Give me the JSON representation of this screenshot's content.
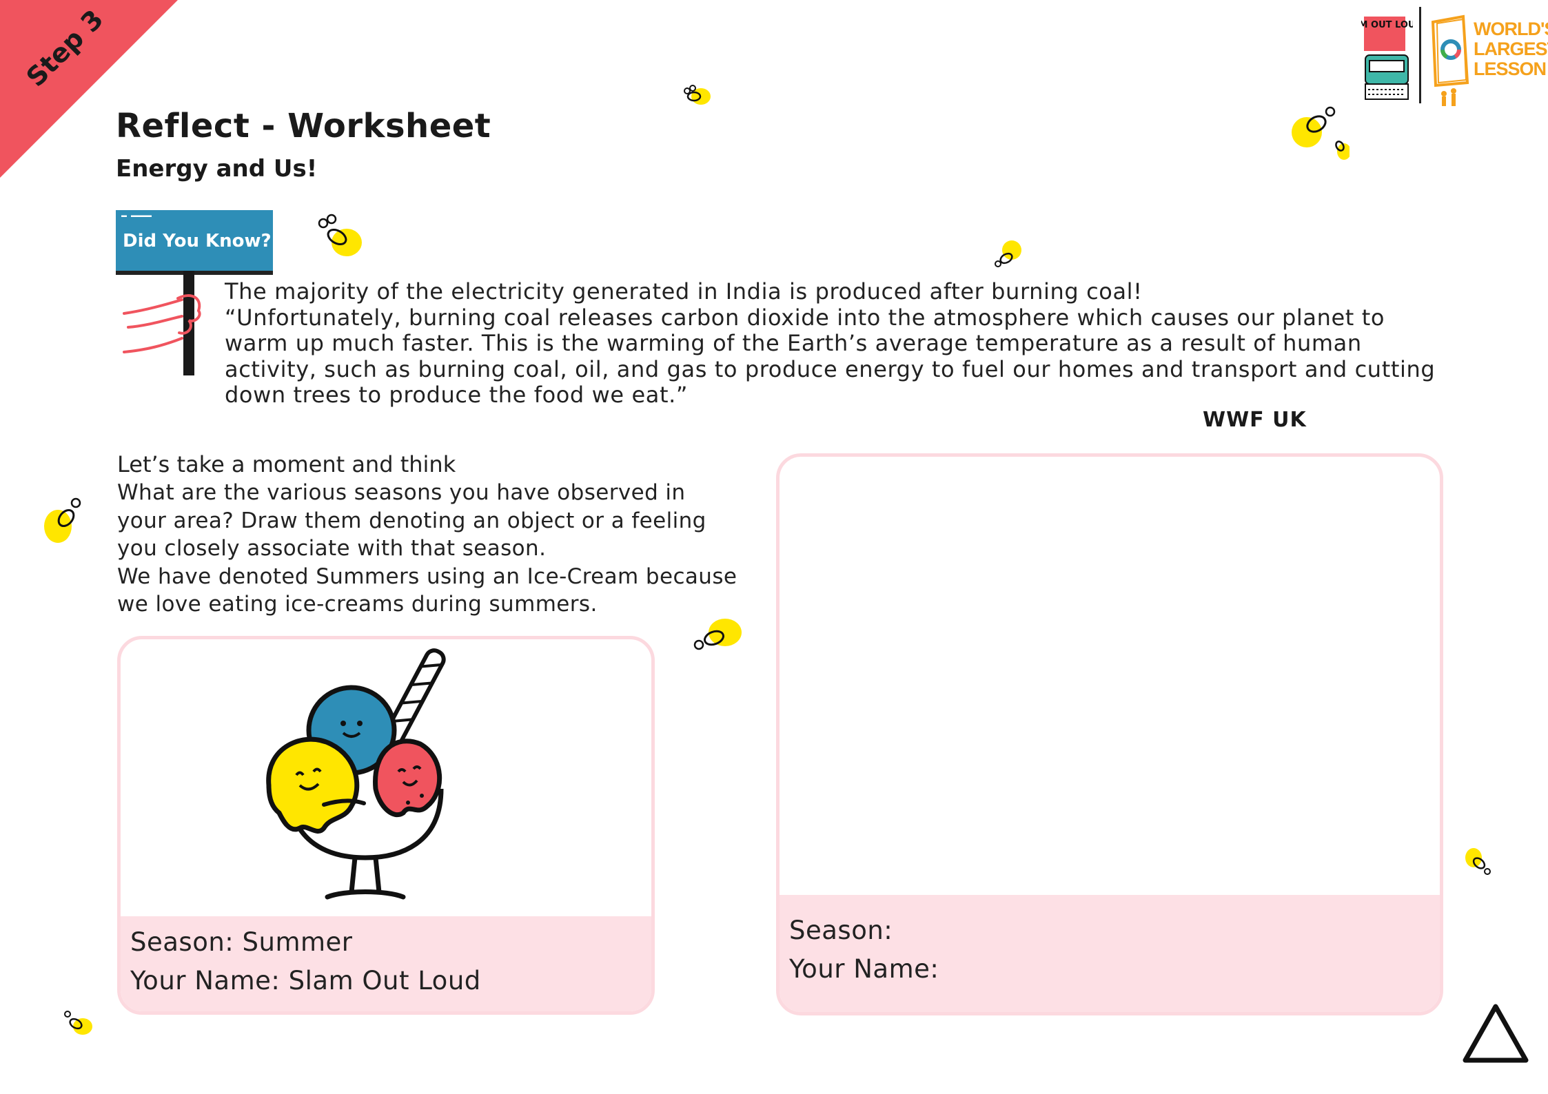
{
  "step_badge": {
    "label": "Step 3",
    "color": "#f0545e"
  },
  "header": {
    "title": "Reflect - Worksheet",
    "subtitle": "Energy and Us!"
  },
  "did_you_know": {
    "sign_label": "Did You Know?",
    "sign_color": "#2e8eb7",
    "line1": "The majority of the electricity generated in India is produced after burning coal!",
    "quote": "“Unfortunately, burning coal releases carbon dioxide into the atmosphere which causes our planet to warm up much faster. This is the warming of the Earth’s average temperature as a result of human activity, such as burning coal, oil, and gas to produce energy to fuel our homes and transport and cutting down trees to produce the food we eat.”",
    "source": "WWF UK"
  },
  "think": {
    "heading": "Let’s take a moment and think",
    "para1": "What are the various seasons you have observed in your area? Draw them denoting an object or a feeling you closely associate with that season.",
    "para2": "We have denoted Summers using an Ice-Cream because we love eating ice-creams during summers."
  },
  "example_card": {
    "season_line": "Season: Summer",
    "name_line": "Your Name: Slam Out Loud",
    "illustration": "ice-cream-sundae"
  },
  "blank_card": {
    "season_line": "Season:",
    "name_line": "Your Name:"
  },
  "logos": {
    "slam_out_loud": "SLAM OUT LOUD!",
    "worlds_largest_lesson": [
      "WORLD'S",
      "LARGEST",
      "LESSON"
    ],
    "wll_color": "#f5a11c"
  },
  "colors": {
    "card_border": "#fcd9df",
    "card_footer": "#fde0e5",
    "bee_yellow": "#ffe600"
  }
}
